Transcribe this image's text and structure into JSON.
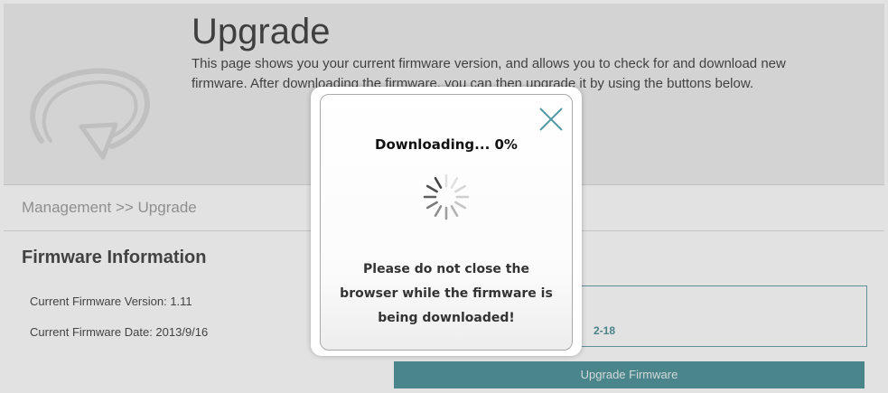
{
  "header": {
    "icon": "refresh-arrow-icon",
    "title": "Upgrade",
    "description": "This page shows you your current firmware version, and allows you to check for and download new firmware. After downloading the firmware, you can then upgrade it by using the buttons below."
  },
  "breadcrumb": "Management >> Upgrade",
  "firmware": {
    "section_title": "Firmware Information",
    "current_version_label": "Current Firmware Version: 1.11",
    "current_date_label": "Current Firmware Date: 2013/9/16"
  },
  "check_panel": {
    "partial_text": "2-18"
  },
  "upgrade_button_label": "Upgrade Firmware",
  "modal": {
    "title": "Downloading... 0%",
    "progress_percent": 0,
    "message": "Please do not close the browser while the firmware is being downloaded!",
    "close_icon": "close-icon",
    "spinner_icon": "loading-spinner-icon"
  },
  "colors": {
    "accent": "#2c7f86",
    "header_bg": "#ebebeb",
    "breadcrumb_text": "#8c8c8c"
  }
}
